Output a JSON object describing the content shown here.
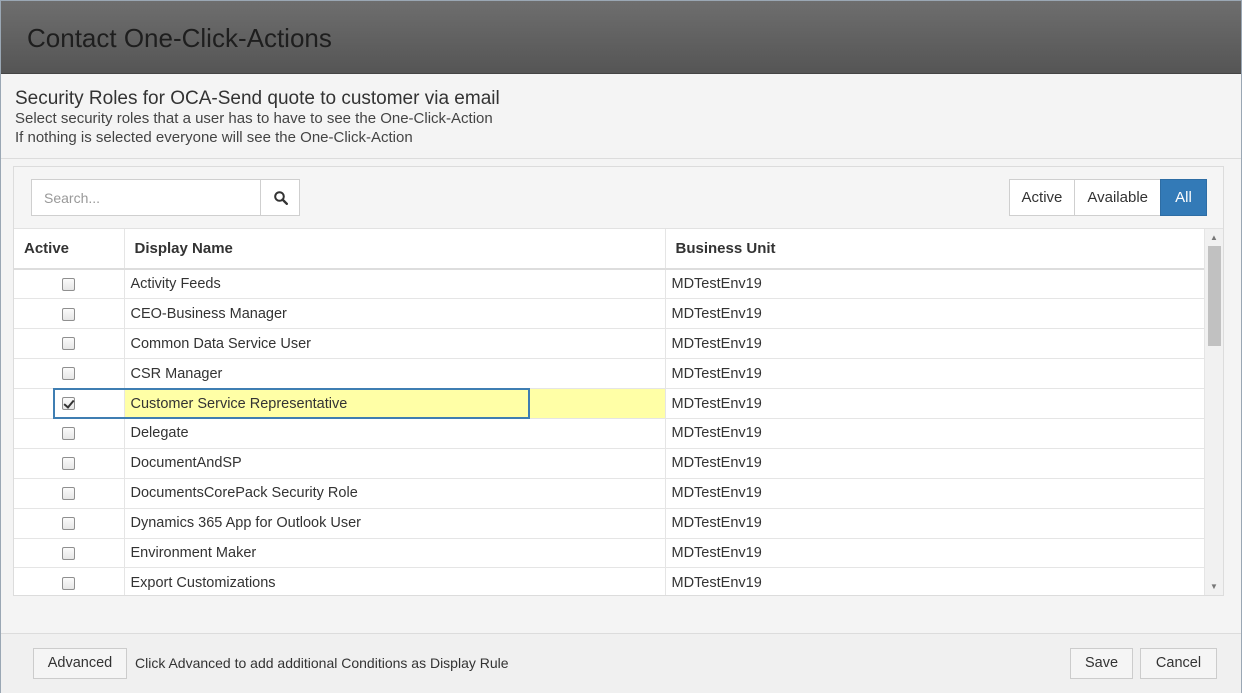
{
  "window": {
    "title": "Contact One-Click-Actions"
  },
  "header": {
    "title": "Security Roles for OCA-Send quote to customer via email",
    "line1": "Select security roles that a user has to have to see the One-Click-Action",
    "line2": "If nothing is selected everyone will see the One-Click-Action"
  },
  "search": {
    "placeholder": "Search...",
    "value": ""
  },
  "filters": {
    "active": "Active",
    "available": "Available",
    "all": "All",
    "selected": "All"
  },
  "table": {
    "headers": {
      "active": "Active",
      "display_name": "Display Name",
      "business_unit": "Business Unit"
    },
    "rows": [
      {
        "checked": false,
        "name": "Activity Feeds",
        "unit": "MDTestEnv19"
      },
      {
        "checked": false,
        "name": "CEO-Business Manager",
        "unit": "MDTestEnv19"
      },
      {
        "checked": false,
        "name": "Common Data Service User",
        "unit": "MDTestEnv19"
      },
      {
        "checked": false,
        "name": "CSR Manager",
        "unit": "MDTestEnv19"
      },
      {
        "checked": true,
        "name": "Customer Service Representative",
        "unit": "MDTestEnv19"
      },
      {
        "checked": false,
        "name": "Delegate",
        "unit": "MDTestEnv19"
      },
      {
        "checked": false,
        "name": "DocumentAndSP",
        "unit": "MDTestEnv19"
      },
      {
        "checked": false,
        "name": "DocumentsCorePack Security Role",
        "unit": "MDTestEnv19"
      },
      {
        "checked": false,
        "name": "Dynamics 365 App for Outlook User",
        "unit": "MDTestEnv19"
      },
      {
        "checked": false,
        "name": "Environment Maker",
        "unit": "MDTestEnv19"
      },
      {
        "checked": false,
        "name": "Export Customizations",
        "unit": "MDTestEnv19"
      }
    ]
  },
  "footer": {
    "advanced_label": "Advanced",
    "hint": "Click Advanced to add additional Conditions as Display Rule",
    "save_label": "Save",
    "cancel_label": "Cancel"
  },
  "colors": {
    "accent": "#337ab7",
    "highlight": "#ffffa6",
    "titlebar": "#5e5e5e"
  }
}
